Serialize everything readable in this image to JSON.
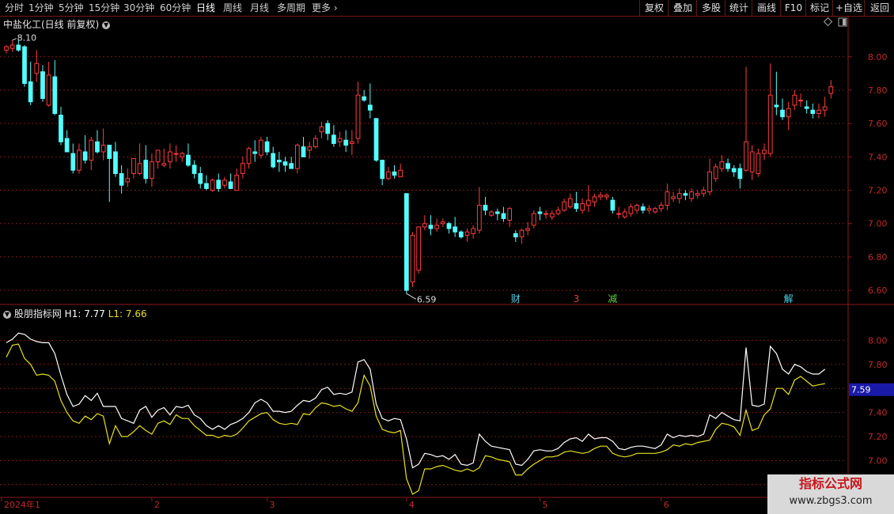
{
  "topbar": {
    "periods": [
      "分时",
      "1分钟",
      "5分钟",
      "15分钟",
      "30分钟",
      "60分钟",
      "日线",
      "周线",
      "月线",
      "多周期",
      "更多"
    ],
    "active_period": "日线",
    "tools": [
      "复权",
      "叠加",
      "多股",
      "统计",
      "画线",
      "F10",
      "标记",
      "+自选",
      "返回"
    ]
  },
  "main_chart": {
    "title": "中盐化工(日线 前复权)",
    "high_label": "8.10",
    "low_label": "6.59",
    "y_ticks": [
      "8.00",
      "7.80",
      "7.60",
      "7.40",
      "7.20",
      "7.00",
      "6.80",
      "6.60"
    ],
    "ylim": [
      6.52,
      8.16
    ],
    "event_markers": [
      {
        "text": "财",
        "index": 84,
        "color": "#4fd4e6"
      },
      {
        "text": "3",
        "index": 94,
        "color": "#e04040"
      },
      {
        "text": "减",
        "index": 100,
        "color": "#60d040"
      },
      {
        "text": "解",
        "index": 129,
        "color": "#4fd4e6"
      }
    ]
  },
  "indicator": {
    "name": "股朋指标网",
    "h1_label": "H1: 7.77",
    "l1_label": "L1: 7.66",
    "current_value": "7.59",
    "y_ticks": [
      "8.00",
      "7.80",
      "7.60",
      "7.40",
      "7.20",
      "7.00",
      "6.80"
    ],
    "ylim": [
      6.7,
      8.2
    ]
  },
  "x_axis": {
    "labels": [
      {
        "text": "2024年1",
        "index": 0
      },
      {
        "text": "2",
        "index": 24
      },
      {
        "text": "3",
        "index": 43
      },
      {
        "text": "4",
        "index": 66
      },
      {
        "text": "5",
        "index": 88
      },
      {
        "text": "6",
        "index": 108
      }
    ]
  },
  "chart_data": {
    "type": "candlestick",
    "title": "中盐化工(日线 前复权)",
    "ohlc": [
      [
        8.04,
        8.07,
        8.06,
        8.02
      ],
      [
        8.05,
        8.1,
        8.07,
        8.03
      ],
      [
        8.07,
        8.1,
        8.04,
        8.03
      ],
      [
        8.06,
        8.07,
        7.84,
        7.82
      ],
      [
        7.85,
        7.97,
        7.73,
        7.71
      ],
      [
        7.9,
        8.04,
        7.96,
        7.85
      ],
      [
        7.91,
        7.95,
        7.75,
        7.73
      ],
      [
        7.71,
        7.97,
        7.89,
        7.7
      ],
      [
        7.88,
        7.98,
        7.66,
        7.65
      ],
      [
        7.65,
        7.7,
        7.49,
        7.47
      ],
      [
        7.51,
        7.56,
        7.43,
        7.43
      ],
      [
        7.42,
        7.48,
        7.32,
        7.3
      ],
      [
        7.32,
        7.48,
        7.44,
        7.3
      ],
      [
        7.43,
        7.53,
        7.38,
        7.36
      ],
      [
        7.38,
        7.52,
        7.5,
        7.32
      ],
      [
        7.49,
        7.56,
        7.43,
        7.42
      ],
      [
        7.43,
        7.57,
        7.47,
        7.38
      ],
      [
        7.47,
        7.47,
        7.39,
        7.13
      ],
      [
        7.43,
        7.49,
        7.3,
        7.28
      ],
      [
        7.3,
        7.35,
        7.23,
        7.18
      ],
      [
        7.25,
        7.33,
        7.27,
        7.22
      ],
      [
        7.3,
        7.35,
        7.39,
        7.27
      ],
      [
        7.3,
        7.48,
        7.36,
        7.29
      ],
      [
        7.38,
        7.47,
        7.27,
        7.24
      ],
      [
        7.27,
        7.42,
        7.37,
        7.22
      ],
      [
        7.37,
        7.44,
        7.44,
        7.33
      ],
      [
        7.35,
        7.45,
        7.36,
        7.34
      ],
      [
        7.37,
        7.48,
        7.43,
        7.33
      ],
      [
        7.42,
        7.47,
        7.42,
        7.37
      ],
      [
        7.4,
        7.43,
        7.42,
        7.37
      ],
      [
        7.41,
        7.48,
        7.35,
        7.34
      ],
      [
        7.35,
        7.38,
        7.3,
        7.27
      ],
      [
        7.3,
        7.34,
        7.24,
        7.21
      ],
      [
        7.24,
        7.29,
        7.21,
        7.2
      ],
      [
        7.2,
        7.27,
        7.26,
        7.19
      ],
      [
        7.26,
        7.3,
        7.21,
        7.19
      ],
      [
        7.23,
        7.28,
        7.26,
        7.21
      ],
      [
        7.25,
        7.3,
        7.21,
        7.21
      ],
      [
        7.2,
        7.33,
        7.29,
        7.2
      ],
      [
        7.3,
        7.4,
        7.36,
        7.27
      ],
      [
        7.36,
        7.46,
        7.45,
        7.33
      ],
      [
        7.43,
        7.5,
        7.42,
        7.37
      ],
      [
        7.41,
        7.52,
        7.5,
        7.39
      ],
      [
        7.49,
        7.52,
        7.43,
        7.41
      ],
      [
        7.42,
        7.46,
        7.34,
        7.33
      ],
      [
        7.38,
        7.43,
        7.37,
        7.31
      ],
      [
        7.37,
        7.4,
        7.35,
        7.31
      ],
      [
        7.36,
        7.4,
        7.33,
        7.33
      ],
      [
        7.33,
        7.48,
        7.47,
        7.3
      ],
      [
        7.46,
        7.52,
        7.4,
        7.4
      ],
      [
        7.44,
        7.49,
        7.46,
        7.39
      ],
      [
        7.46,
        7.53,
        7.51,
        7.45
      ],
      [
        7.55,
        7.61,
        7.58,
        7.51
      ],
      [
        7.6,
        7.62,
        7.54,
        7.5
      ],
      [
        7.53,
        7.59,
        7.48,
        7.46
      ],
      [
        7.49,
        7.55,
        7.51,
        7.46
      ],
      [
        7.5,
        7.56,
        7.47,
        7.43
      ],
      [
        7.48,
        7.56,
        7.49,
        7.41
      ],
      [
        7.51,
        7.85,
        7.77,
        7.48
      ],
      [
        7.76,
        7.8,
        7.74,
        7.73
      ],
      [
        7.71,
        7.84,
        7.68,
        7.63
      ],
      [
        7.63,
        7.63,
        7.38,
        7.37
      ],
      [
        7.38,
        7.38,
        7.27,
        7.23
      ],
      [
        7.27,
        7.34,
        7.31,
        7.26
      ],
      [
        7.31,
        7.35,
        7.29,
        7.27
      ],
      [
        7.28,
        7.36,
        7.32,
        7.28
      ],
      [
        7.18,
        7.18,
        6.6,
        6.58
      ],
      [
        6.65,
        6.95,
        6.93,
        6.62
      ],
      [
        6.72,
        6.96,
        6.98,
        6.7
      ],
      [
        6.98,
        7.05,
        7.0,
        6.96
      ],
      [
        6.99,
        7.05,
        6.97,
        6.93
      ],
      [
        6.97,
        7.03,
        6.99,
        6.95
      ],
      [
        7.0,
        7.03,
        7.01,
        6.98
      ],
      [
        7.0,
        7.01,
        6.97,
        6.94
      ],
      [
        6.98,
        7.04,
        6.95,
        6.92
      ],
      [
        6.95,
        6.96,
        6.92,
        6.91
      ],
      [
        6.93,
        6.97,
        6.95,
        6.89
      ],
      [
        6.94,
        6.99,
        6.97,
        6.91
      ],
      [
        6.96,
        7.22,
        7.11,
        6.94
      ],
      [
        7.11,
        7.16,
        7.08,
        7.05
      ],
      [
        7.05,
        7.08,
        7.07,
        7.04
      ],
      [
        7.07,
        7.09,
        7.06,
        7.02
      ],
      [
        7.06,
        7.1,
        7.03,
        7.01
      ],
      [
        7.02,
        7.1,
        7.09,
        6.98
      ],
      [
        6.94,
        6.96,
        6.92,
        6.89
      ],
      [
        6.92,
        6.97,
        6.96,
        6.88
      ],
      [
        6.96,
        7.01,
        6.97,
        6.93
      ],
      [
        6.99,
        7.08,
        7.06,
        6.97
      ],
      [
        7.07,
        7.1,
        7.06,
        7.02
      ],
      [
        7.06,
        7.08,
        7.06,
        7.03
      ],
      [
        7.04,
        7.08,
        7.06,
        7.02
      ],
      [
        7.06,
        7.1,
        7.08,
        7.05
      ],
      [
        7.08,
        7.15,
        7.13,
        7.07
      ],
      [
        7.1,
        7.18,
        7.15,
        7.09
      ],
      [
        7.12,
        7.19,
        7.09,
        7.07
      ],
      [
        7.08,
        7.15,
        7.12,
        7.06
      ],
      [
        7.11,
        7.23,
        7.14,
        7.07
      ],
      [
        7.13,
        7.18,
        7.16,
        7.1
      ],
      [
        7.16,
        7.19,
        7.17,
        7.14
      ],
      [
        7.16,
        7.18,
        7.17,
        7.14
      ],
      [
        7.14,
        7.16,
        7.08,
        7.06
      ],
      [
        7.06,
        7.1,
        7.06,
        7.03
      ],
      [
        7.04,
        7.09,
        7.07,
        7.03
      ],
      [
        7.06,
        7.12,
        7.1,
        7.04
      ],
      [
        7.08,
        7.12,
        7.11,
        7.06
      ],
      [
        7.1,
        7.12,
        7.08,
        7.06
      ],
      [
        7.08,
        7.11,
        7.09,
        7.06
      ],
      [
        7.07,
        7.1,
        7.09,
        7.06
      ],
      [
        7.09,
        7.13,
        7.11,
        7.07
      ],
      [
        7.11,
        7.24,
        7.19,
        7.08
      ],
      [
        7.15,
        7.19,
        7.16,
        7.13
      ],
      [
        7.15,
        7.21,
        7.18,
        7.12
      ],
      [
        7.18,
        7.2,
        7.17,
        7.14
      ],
      [
        7.15,
        7.21,
        7.19,
        7.13
      ],
      [
        7.17,
        7.2,
        7.18,
        7.15
      ],
      [
        7.18,
        7.22,
        7.2,
        7.16
      ],
      [
        7.19,
        7.39,
        7.31,
        7.17
      ],
      [
        7.27,
        7.36,
        7.34,
        7.25
      ],
      [
        7.33,
        7.41,
        7.37,
        7.31
      ],
      [
        7.36,
        7.39,
        7.33,
        7.31
      ],
      [
        7.33,
        7.35,
        7.31,
        7.28
      ],
      [
        7.33,
        7.36,
        7.27,
        7.21
      ],
      [
        7.32,
        7.94,
        7.49,
        7.31
      ],
      [
        7.31,
        7.47,
        7.43,
        7.26
      ],
      [
        7.3,
        7.45,
        7.42,
        7.28
      ],
      [
        7.42,
        7.48,
        7.44,
        7.38
      ],
      [
        7.42,
        7.96,
        7.77,
        7.4
      ],
      [
        7.71,
        7.91,
        7.7,
        7.65
      ],
      [
        7.68,
        7.75,
        7.64,
        7.62
      ],
      [
        7.64,
        7.73,
        7.69,
        7.56
      ],
      [
        7.71,
        7.8,
        7.77,
        7.68
      ],
      [
        7.74,
        7.78,
        7.74,
        7.7
      ],
      [
        7.7,
        7.74,
        7.69,
        7.66
      ],
      [
        7.68,
        7.72,
        7.66,
        7.63
      ],
      [
        7.66,
        7.72,
        7.68,
        7.63
      ],
      [
        7.68,
        7.76,
        7.7,
        7.64
      ],
      [
        7.78,
        7.86,
        7.82,
        7.75
      ]
    ],
    "indicator_series": [
      {
        "name": "H1",
        "color": "#ffffff",
        "values": [
          7.98,
          8.01,
          8.06,
          8.05,
          8.01,
          7.99,
          7.98,
          7.98,
          7.89,
          7.71,
          7.55,
          7.45,
          7.47,
          7.54,
          7.5,
          7.56,
          7.45,
          7.45,
          7.45,
          7.35,
          7.33,
          7.31,
          7.42,
          7.45,
          7.36,
          7.42,
          7.44,
          7.38,
          7.45,
          7.44,
          7.46,
          7.38,
          7.35,
          7.29,
          7.26,
          7.29,
          7.26,
          7.3,
          7.32,
          7.35,
          7.4,
          7.48,
          7.51,
          7.48,
          7.41,
          7.41,
          7.4,
          7.41,
          7.46,
          7.5,
          7.49,
          7.52,
          7.59,
          7.61,
          7.55,
          7.56,
          7.55,
          7.57,
          7.82,
          7.84,
          7.76,
          7.47,
          7.35,
          7.33,
          7.35,
          7.34,
          7.18,
          6.94,
          6.97,
          7.06,
          7.05,
          7.03,
          7.04,
          7.01,
          7.05,
          6.97,
          6.96,
          6.98,
          7.22,
          7.16,
          7.12,
          7.11,
          7.1,
          7.09,
          6.97,
          6.96,
          7.01,
          7.08,
          7.09,
          7.08,
          7.08,
          7.1,
          7.15,
          7.18,
          7.19,
          7.16,
          7.22,
          7.18,
          7.19,
          7.19,
          7.16,
          7.1,
          7.09,
          7.11,
          7.12,
          7.12,
          7.11,
          7.1,
          7.13,
          7.22,
          7.19,
          7.21,
          7.2,
          7.21,
          7.2,
          7.22,
          7.38,
          7.35,
          7.4,
          7.37,
          7.34,
          7.33,
          7.94,
          7.46,
          7.45,
          7.47,
          7.95,
          7.89,
          7.76,
          7.72,
          7.8,
          7.78,
          7.74,
          7.72,
          7.72,
          7.76
        ]
      },
      {
        "name": "L1",
        "color": "#e8e020",
        "values": [
          7.86,
          7.96,
          7.97,
          7.85,
          7.8,
          7.71,
          7.72,
          7.71,
          7.66,
          7.5,
          7.4,
          7.33,
          7.31,
          7.37,
          7.34,
          7.39,
          7.37,
          7.14,
          7.29,
          7.2,
          7.2,
          7.24,
          7.29,
          7.25,
          7.22,
          7.31,
          7.33,
          7.3,
          7.38,
          7.35,
          7.35,
          7.29,
          7.25,
          7.21,
          7.21,
          7.19,
          7.21,
          7.2,
          7.22,
          7.27,
          7.33,
          7.36,
          7.39,
          7.4,
          7.34,
          7.31,
          7.3,
          7.31,
          7.3,
          7.39,
          7.38,
          7.44,
          7.48,
          7.47,
          7.45,
          7.46,
          7.43,
          7.41,
          7.48,
          7.71,
          7.62,
          7.37,
          7.26,
          7.24,
          7.23,
          7.25,
          6.85,
          6.72,
          6.75,
          6.93,
          6.93,
          6.95,
          6.96,
          6.94,
          6.92,
          6.91,
          6.93,
          6.91,
          6.94,
          7.04,
          7.03,
          7.01,
          7.0,
          6.99,
          6.88,
          6.88,
          6.93,
          6.97,
          7.0,
          7.03,
          7.03,
          7.04,
          7.07,
          7.08,
          7.07,
          7.06,
          7.07,
          7.1,
          7.12,
          7.12,
          7.06,
          7.04,
          7.03,
          7.04,
          7.06,
          7.06,
          7.06,
          7.06,
          7.07,
          7.09,
          7.13,
          7.12,
          7.14,
          7.13,
          7.15,
          7.16,
          7.17,
          7.26,
          7.31,
          7.3,
          7.28,
          7.21,
          7.42,
          7.25,
          7.27,
          7.38,
          7.43,
          7.6,
          7.6,
          7.55,
          7.67,
          7.7,
          7.66,
          7.62,
          7.63,
          7.64
        ]
      }
    ]
  },
  "watermark": {
    "line1": "指标公式网",
    "line2": "www.zbgs3.com"
  }
}
